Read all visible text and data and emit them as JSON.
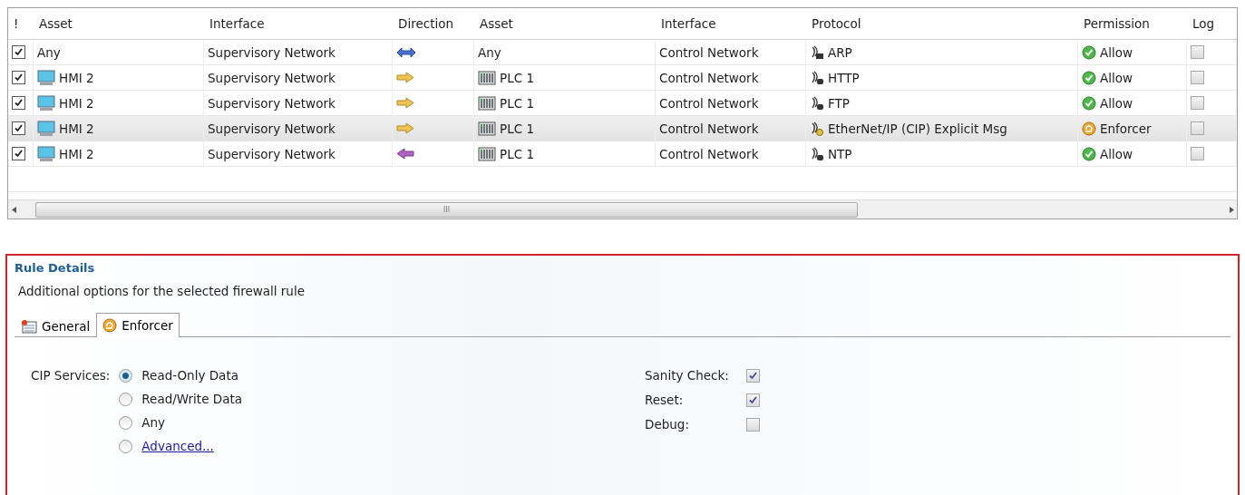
{
  "table": {
    "columns": [
      "!",
      "Asset",
      "Interface",
      "Direction",
      "Asset",
      "Interface",
      "Protocol",
      "Permission",
      "Log"
    ],
    "rows": [
      {
        "enabled": true,
        "selected": false,
        "source": {
          "text": "Any"
        },
        "source_interface": "Supervisory Network",
        "direction": {
          "kind": "both"
        },
        "dest": {
          "text": "Any"
        },
        "dest_interface": "Control Network",
        "protocol": {
          "text": "ARP",
          "kind": "eth"
        },
        "permission": {
          "text": "Allow",
          "kind": "allow"
        },
        "log": false
      },
      {
        "enabled": true,
        "selected": false,
        "source": {
          "text": "HMI 2",
          "kind": "hmi"
        },
        "source_interface": "Supervisory Network",
        "direction": {
          "kind": "right"
        },
        "dest": {
          "text": "PLC 1",
          "kind": "plc"
        },
        "dest_interface": "Control Network",
        "protocol": {
          "text": "HTTP",
          "kind": "ip"
        },
        "permission": {
          "text": "Allow",
          "kind": "allow"
        },
        "log": false
      },
      {
        "enabled": true,
        "selected": false,
        "source": {
          "text": "HMI 2",
          "kind": "hmi"
        },
        "source_interface": "Supervisory Network",
        "direction": {
          "kind": "right"
        },
        "dest": {
          "text": "PLC 1",
          "kind": "plc"
        },
        "dest_interface": "Control Network",
        "protocol": {
          "text": "FTP",
          "kind": "ip"
        },
        "permission": {
          "text": "Allow",
          "kind": "allow"
        },
        "log": false
      },
      {
        "enabled": true,
        "selected": true,
        "source": {
          "text": "HMI 2",
          "kind": "hmi"
        },
        "source_interface": "Supervisory Network",
        "direction": {
          "kind": "right"
        },
        "dest": {
          "text": "PLC 1",
          "kind": "plc"
        },
        "dest_interface": "Control Network",
        "protocol": {
          "text": "EtherNet/IP (CIP) Explicit Msg",
          "kind": "cip"
        },
        "permission": {
          "text": "Enforcer",
          "kind": "enforcer"
        },
        "log": false
      },
      {
        "enabled": true,
        "selected": false,
        "source": {
          "text": "HMI 2",
          "kind": "hmi"
        },
        "source_interface": "Supervisory Network",
        "direction": {
          "kind": "left"
        },
        "dest": {
          "text": "PLC 1",
          "kind": "plc"
        },
        "dest_interface": "Control Network",
        "protocol": {
          "text": "NTP",
          "kind": "ip"
        },
        "permission": {
          "text": "Allow",
          "kind": "allow"
        },
        "log": false
      }
    ],
    "scrollbar_grip": "III"
  },
  "details": {
    "title": "Rule Details",
    "description": "Additional options for the selected firewall rule",
    "tabs": [
      {
        "label": "General",
        "kind": "general",
        "selected": false
      },
      {
        "label": "Enforcer",
        "kind": "enforcer",
        "selected": true
      }
    ],
    "cip_label": "CIP Services:",
    "cip_options": [
      {
        "label": "Read-Only Data",
        "kind": "plain",
        "selected": true
      },
      {
        "label": "Read/Write Data",
        "kind": "plain",
        "selected": false
      },
      {
        "label": "Any",
        "kind": "plain",
        "selected": false
      },
      {
        "label": "Advanced...",
        "kind": "link",
        "selected": false
      }
    ],
    "checks": [
      {
        "label": "Sanity Check:",
        "checked": true
      },
      {
        "label": "Reset:",
        "checked": true
      },
      {
        "label": "Debug:",
        "checked": false
      }
    ]
  }
}
